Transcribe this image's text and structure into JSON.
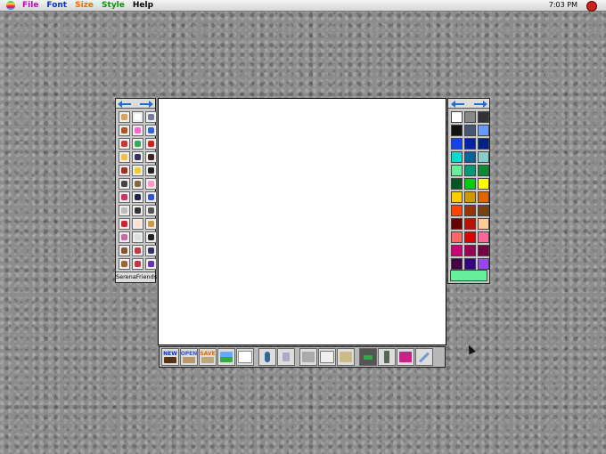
{
  "menubar": {
    "menus": [
      {
        "label": "File",
        "color": "#cc00cc"
      },
      {
        "label": "Font",
        "color": "#0033cc"
      },
      {
        "label": "Size",
        "color": "#ff6600"
      },
      {
        "label": "Style",
        "color": "#009900"
      },
      {
        "label": "Help",
        "color": "#000000"
      }
    ],
    "clock": "7:03 PM"
  },
  "tool_palette": {
    "label": "SerenaFriends",
    "tools": [
      {
        "icon": "hand-icon",
        "color": "#d9a060"
      },
      {
        "icon": "paint-bucket-icon",
        "color": "#ffffff"
      },
      {
        "icon": "sound-icon",
        "color": "#7a7a9a"
      },
      {
        "icon": "pencil-icon",
        "color": "#aa5522"
      },
      {
        "icon": "sparkle-icon",
        "color": "#ff66cc"
      },
      {
        "icon": "line-icon",
        "color": "#3366cc"
      },
      {
        "icon": "shapes-icon",
        "color": "#cc3333"
      },
      {
        "icon": "fill-pattern-icon",
        "color": "#33aa55"
      },
      {
        "icon": "text-icon",
        "color": "#cc2222"
      },
      {
        "icon": "girl-blonde-icon",
        "color": "#f0c040"
      },
      {
        "icon": "girl-dark-icon",
        "color": "#333366"
      },
      {
        "icon": "girl-brunette-icon",
        "color": "#442222"
      },
      {
        "icon": "girl-red-icon",
        "color": "#993322"
      },
      {
        "icon": "girl-yellow-icon",
        "color": "#eecc33"
      },
      {
        "icon": "girl-black-icon",
        "color": "#222222"
      },
      {
        "icon": "cat-icon",
        "color": "#444444"
      },
      {
        "icon": "dog-icon",
        "color": "#886644"
      },
      {
        "icon": "pig-icon",
        "color": "#ff99cc"
      },
      {
        "icon": "locker-icon",
        "color": "#cc3366"
      },
      {
        "icon": "purse-icon",
        "color": "#222244"
      },
      {
        "icon": "book-icon",
        "color": "#3355cc"
      },
      {
        "icon": "clock-icon",
        "color": "#bbbbbb"
      },
      {
        "icon": "camera-icon",
        "color": "#333333"
      },
      {
        "icon": "phone-icon",
        "color": "#555555"
      },
      {
        "icon": "lipstick-icon",
        "color": "#cc2233"
      },
      {
        "icon": "ice-cream-icon",
        "color": "#ffddcc"
      },
      {
        "icon": "burger-icon",
        "color": "#cc9944"
      },
      {
        "icon": "drink-icon",
        "color": "#cc66aa"
      },
      {
        "icon": "moon-icon",
        "color": "#dddddd"
      },
      {
        "icon": "sunglasses-icon",
        "color": "#222222"
      },
      {
        "icon": "comb-icon",
        "color": "#885533"
      },
      {
        "icon": "bow-icon",
        "color": "#cc3344"
      },
      {
        "icon": "keyboard-icon",
        "color": "#333366"
      },
      {
        "icon": "brush-icon",
        "color": "#996633"
      },
      {
        "icon": "flowers-icon",
        "color": "#cc3344"
      },
      {
        "icon": "bag-icon",
        "color": "#6633aa"
      }
    ]
  },
  "color_palette": {
    "colors": [
      "#ffffff",
      "#888888",
      "#333333",
      "#111111",
      "#445577",
      "#6699ff",
      "#1144ee",
      "#0022aa",
      "#002288",
      "#00ddcc",
      "#006699",
      "#88cccc",
      "#66ee99",
      "#009977",
      "#118833",
      "#005522",
      "#00cc11",
      "#ffff00",
      "#ffcc00",
      "#cc9900",
      "#dd6600",
      "#ff4400",
      "#993300",
      "#774411",
      "#660000",
      "#bb1100",
      "#ffcc99",
      "#ff6666",
      "#dd0000",
      "#ff6699",
      "#cc0077",
      "#990055",
      "#770044",
      "#440044",
      "#330088",
      "#9944ee"
    ],
    "current": "#66ee99"
  },
  "toolbar": {
    "new_label": "NEW",
    "open_label": "OPEN",
    "save_label": "SAVE"
  }
}
